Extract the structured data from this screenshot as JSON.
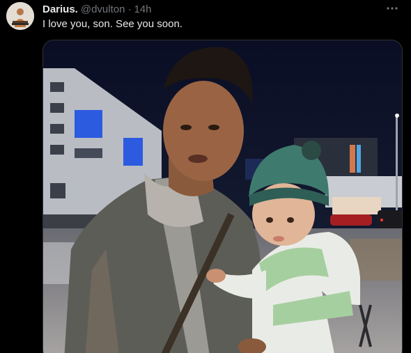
{
  "author": {
    "display_name": "Darius.",
    "handle": "@dvulton",
    "separator": "·",
    "time": "14h"
  },
  "tweet": {
    "text": "I love you, son. See you soon."
  },
  "media": {
    "alt": "Photo"
  },
  "icons": {
    "more": "more-dots-icon"
  },
  "colors": {
    "background": "#000000",
    "primary_text": "#e7e9ea",
    "secondary_text": "#71767b",
    "border": "#2f3336"
  }
}
